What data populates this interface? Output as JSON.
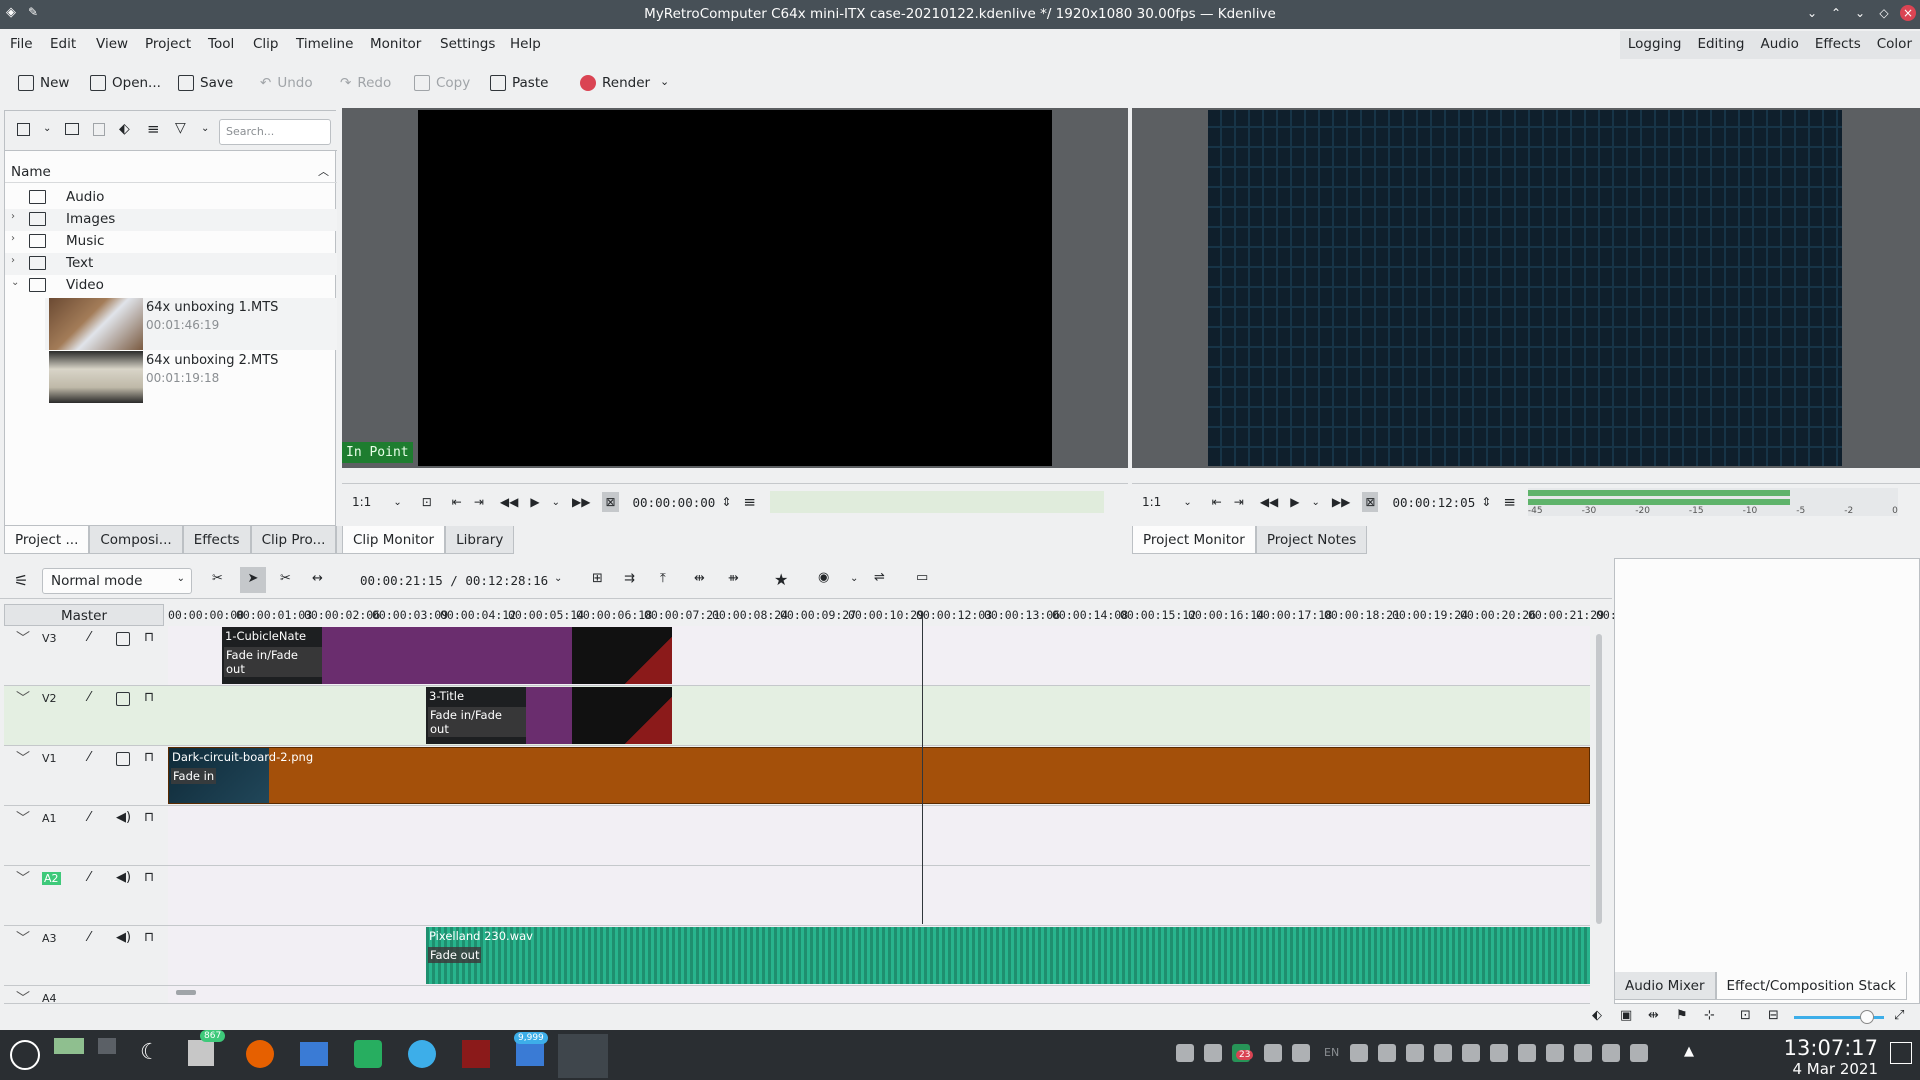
{
  "window": {
    "title": "MyRetroComputer C64x mini-ITX case-20210122.kdenlive */ 1920x1080 30.00fps — Kdenlive"
  },
  "menu": {
    "items": [
      "File",
      "Edit",
      "View",
      "Project",
      "Tool",
      "Clip",
      "Timeline",
      "Monitor",
      "Settings",
      "Help"
    ]
  },
  "layouts": [
    "Logging",
    "Editing",
    "Audio",
    "Effects",
    "Color"
  ],
  "toolbar": {
    "new": "New",
    "open": "Open...",
    "save": "Save",
    "undo": "Undo",
    "redo": "Redo",
    "copy": "Copy",
    "paste": "Paste",
    "render": "Render"
  },
  "bin": {
    "search_placeholder": "Search...",
    "column": "Name",
    "folders": [
      "Audio",
      "Images",
      "Music",
      "Text",
      "Video"
    ],
    "clips": [
      {
        "name": "64x unboxing 1.MTS",
        "duration": "00:01:46:19"
      },
      {
        "name": "64x unboxing 2.MTS",
        "duration": "00:01:19:18"
      }
    ],
    "tabs": [
      "Project ...",
      "Composi...",
      "Effects",
      "Clip Pro..."
    ]
  },
  "clip_monitor": {
    "overlay": "In Point",
    "zoom": "1:1",
    "timecode": "00:00:00:00",
    "tabs": [
      "Clip Monitor",
      "Library"
    ]
  },
  "project_monitor": {
    "zoom": "1:1",
    "timecode": "00:00:12:05",
    "tabs": [
      "Project Monitor",
      "Project Notes"
    ],
    "meter_labels": [
      "-45",
      "-30",
      "-20",
      "-15",
      "-10",
      "-5",
      "-2",
      "0"
    ]
  },
  "timeline": {
    "mode": "Normal mode",
    "position": "00:00:21:15 / 00:12:28:16",
    "master": "Master",
    "ruler": [
      "00:00:00:00",
      "00:00:01:03",
      "00:00:02:06",
      "00:00:03:09",
      "00:00:04:12",
      "00:00:05:14",
      "00:00:06:18",
      "00:00:07:21",
      "00:00:08:24",
      "00:00:09:27",
      "00:00:10:29",
      "00:00:12:03",
      "00:00:13:06",
      "00:00:14:08",
      "00:00:15:12",
      "00:00:16:14",
      "00:00:17:18",
      "00:00:18:21",
      "00:00:19:24",
      "00:00:20:26",
      "00:00:21:29",
      "00:"
    ],
    "tracks": [
      "V3",
      "V2",
      "V1",
      "A1",
      "A2",
      "A3",
      "A4"
    ],
    "clips": {
      "v3_title": "1-CubicleNate",
      "v3_fade": "Fade in/Fade out",
      "v2_title": "3-Title",
      "v2_fade": "Fade in/Fade out",
      "v1_title": "Dark-circuit-board-2.png",
      "v1_fade": "Fade in",
      "a3_title": "Pixelland 230.wav",
      "a3_fade": "Fade out"
    }
  },
  "right_tabs": [
    "Audio Mixer",
    "Effect/Composition Stack"
  ],
  "taskbar": {
    "badge1": "867",
    "badge2": "9,999",
    "badge3": "23",
    "time": "13:07:17",
    "date": "4 Mar 2021",
    "lang": "EN"
  }
}
